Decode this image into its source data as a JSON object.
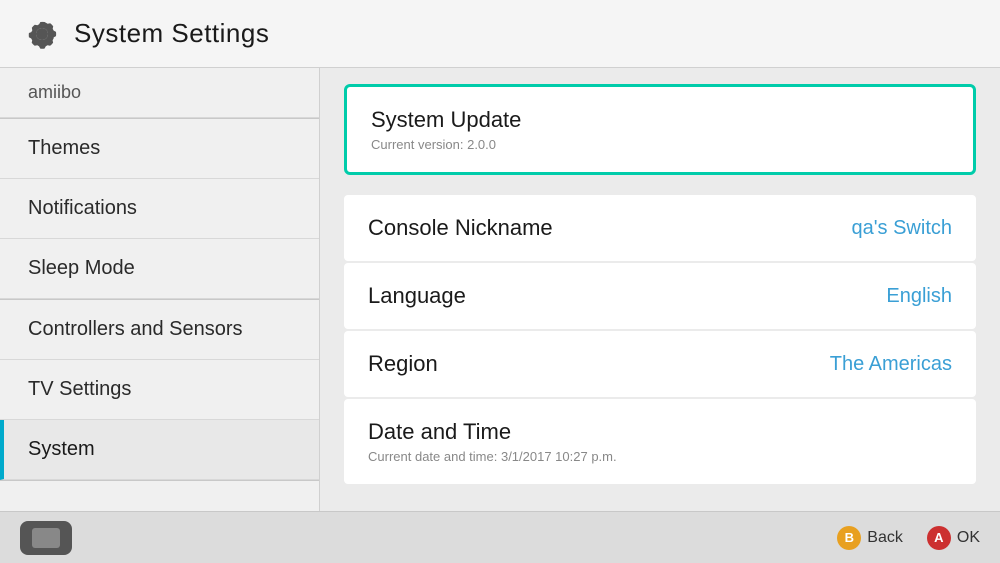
{
  "header": {
    "title": "System Settings",
    "icon": "gear"
  },
  "sidebar": {
    "items": [
      {
        "id": "amiibo",
        "label": "amiibo",
        "active": false,
        "group": 0
      },
      {
        "id": "themes",
        "label": "Themes",
        "active": false,
        "group": 1
      },
      {
        "id": "notifications",
        "label": "Notifications",
        "active": false,
        "group": 1
      },
      {
        "id": "sleep-mode",
        "label": "Sleep Mode",
        "active": false,
        "group": 1
      },
      {
        "id": "controllers-sensors",
        "label": "Controllers and Sensors",
        "active": false,
        "group": 2
      },
      {
        "id": "tv-settings",
        "label": "TV Settings",
        "active": false,
        "group": 2
      },
      {
        "id": "system",
        "label": "System",
        "active": true,
        "group": 2
      }
    ]
  },
  "content": {
    "items": [
      {
        "id": "system-update",
        "title": "System Update",
        "subtitle": "Current version: 2.0.0",
        "value": "",
        "selected": true
      },
      {
        "id": "console-nickname",
        "title": "Console Nickname",
        "subtitle": "",
        "value": "qa's Switch",
        "selected": false
      },
      {
        "id": "language",
        "title": "Language",
        "subtitle": "",
        "value": "English",
        "selected": false
      },
      {
        "id": "region",
        "title": "Region",
        "subtitle": "",
        "value": "The Americas",
        "selected": false
      },
      {
        "id": "date-and-time",
        "title": "Date and Time",
        "subtitle": "Current date and time: 3/1/2017 10:27 p.m.",
        "value": "",
        "selected": false
      }
    ]
  },
  "footer": {
    "back_label": "Back",
    "ok_label": "OK",
    "b_key": "B",
    "a_key": "A"
  }
}
